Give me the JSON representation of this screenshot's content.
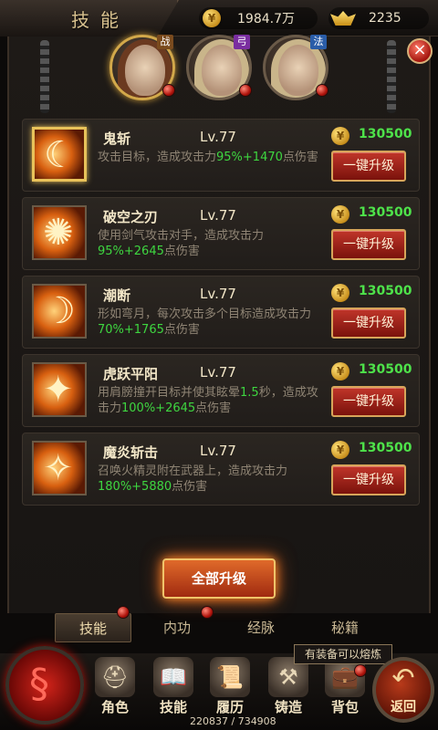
{
  "header": {
    "title": "技能",
    "gold": "1984.7万",
    "ingot": "2235"
  },
  "heroes": [
    {
      "tag": "战",
      "active": true
    },
    {
      "tag": "弓",
      "active": false
    },
    {
      "tag": "法",
      "active": false
    }
  ],
  "close_label": "×",
  "skills": [
    {
      "name": "鬼斩",
      "level": "Lv.77",
      "desc_pre": "攻击目标，造成攻击力",
      "desc_hl": "95%+1470",
      "desc_post": "点伤害",
      "cost": "130500",
      "button": "一键升级"
    },
    {
      "name": "破空之刃",
      "level": "Lv.77",
      "desc_pre": "使用剑气攻击对手，造成攻击力",
      "desc_hl": "95%+2645",
      "desc_post": "点伤害",
      "cost": "130500",
      "button": "一键升级"
    },
    {
      "name": "潮断",
      "level": "Lv.77",
      "desc_pre": "形如弯月，每次攻击多个目标造成攻击力",
      "desc_hl": "70%+1765",
      "desc_post": "点伤害",
      "cost": "130500",
      "button": "一键升级"
    },
    {
      "name": "虎跃平阳",
      "level": "Lv.77",
      "desc_pre": "用肩膀撞开目标并使其眩晕",
      "desc_hl2": "1.5",
      "desc_mid": "秒，造成攻击力",
      "desc_hl": "100%+2645",
      "desc_post": "点伤害",
      "cost": "130500",
      "button": "一键升级"
    },
    {
      "name": "魔炎斩击",
      "level": "Lv.77",
      "desc_pre": "召唤火精灵附在武器上，造成攻击力",
      "desc_hl": "180%+5880",
      "desc_post": "点伤害",
      "cost": "130500",
      "button": "一键升级"
    }
  ],
  "all_upgrade": "全部升级",
  "tabs": [
    "技能",
    "内功",
    "经脉",
    "秘籍"
  ],
  "tooltip": "有装备可以熔炼",
  "nav": [
    "角色",
    "技能",
    "履历",
    "铸造",
    "背包"
  ],
  "return_label": "返回",
  "xp": "220837 / 734908",
  "colors": {
    "highlight": "#3ed640",
    "cost": "#4ee24a",
    "accent_gold": "#d9c28f"
  }
}
